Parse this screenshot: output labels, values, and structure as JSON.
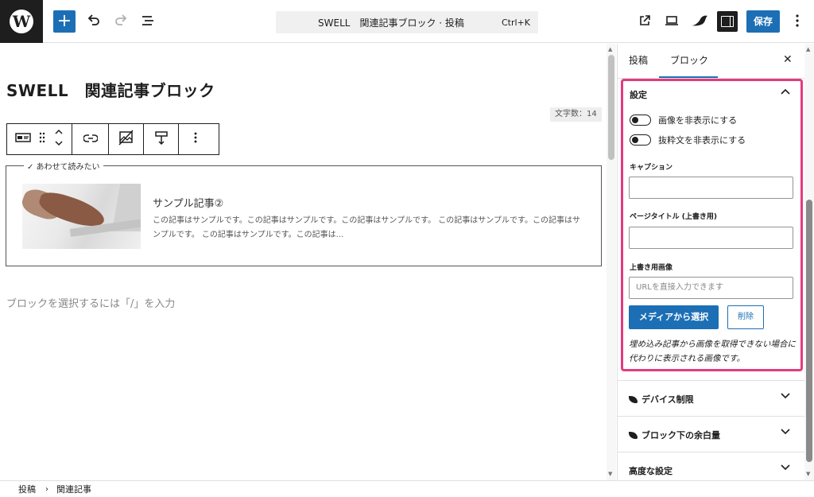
{
  "topbar": {
    "document_bar_title": "SWELL　関連記事ブロック · 投稿",
    "document_bar_shortcut": "Ctrl+K",
    "save_label": "保存",
    "add_symbol": "+",
    "icons": [
      "wordpress-logo",
      "add-block",
      "undo",
      "redo",
      "document-overview",
      "view-post",
      "preview",
      "swell",
      "settings",
      "options"
    ]
  },
  "editor": {
    "post_title": "SWELL　関連記事ブロック",
    "word_count": "文字数：14",
    "related_block": {
      "legend": "✓ あわせて読みたい",
      "title": "サンプル記事②",
      "excerpt": "この記事はサンプルです。この記事はサンプルです。この記事はサンプルです。 この記事はサンプルです。この記事はサンプルです。 この記事はサンプルです。この記事は..."
    },
    "appender_placeholder": "ブロックを選択するには「/」を入力"
  },
  "sidebar": {
    "tabs": [
      "投稿",
      "ブロック"
    ],
    "active_tab": "ブロック",
    "settings_panel": {
      "title": "設定",
      "toggles": [
        {
          "label": "画像を非表示にする",
          "checked": false
        },
        {
          "label": "抜粋文を非表示にする",
          "checked": false
        }
      ],
      "caption_label": "キャプション",
      "caption_value": "",
      "page_title_label": "ページタイトル (上書き用)",
      "page_title_value": "",
      "override_image_label": "上書き用画像",
      "url_placeholder": "URLを直接入力できます",
      "media_button": "メディアから選択",
      "delete_button": "削除",
      "note": "埋め込み記事から画像を取得できない場合に代わりに表示される画像です。"
    },
    "panels": [
      "デバイス制限",
      "ブロック下の余白量",
      "高度な設定"
    ]
  },
  "breadcrumb": [
    "投稿",
    "関連記事"
  ],
  "colors": {
    "accent": "#1c6fb5",
    "highlight": "#e43a7e",
    "dark": "#1e1e1e"
  }
}
